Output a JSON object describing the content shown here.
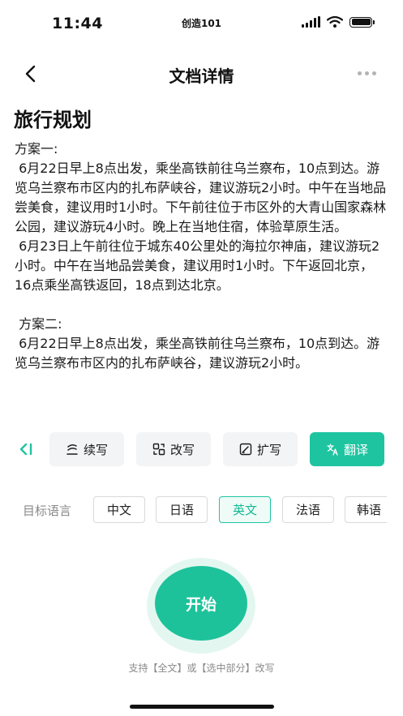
{
  "status_bar": {
    "time": "11:44",
    "carrier": "创造101"
  },
  "nav": {
    "title": "文档详情"
  },
  "document": {
    "title": "旅行规划",
    "body": "方案一:\n 6月22日早上8点出发，乘坐高铁前往乌兰察布，10点到达。游览乌兰察布市区内的扎布萨峡谷，建议游玩2小时。中午在当地品尝美食，建议用时1小时。下午前往位于市区外的大青山国家森林公园，建议游玩4小时。晚上在当地住宿，体验草原生活。\n 6月23日上午前往位于城东40公里处的海拉尔神庙，建议游玩2小时。中午在当地品尝美食，建议用时1小时。下午返回北京，16点乘坐高铁返回，18点到达北京。\n\n 方案二:\n 6月22日早上8点出发，乘坐高铁前往乌兰察布，10点到达。游览乌兰察布市区内的扎布萨峡谷，建议游玩2小时。"
  },
  "toolbar": {
    "buttons": [
      {
        "label": "续写",
        "icon": "continue-write-icon"
      },
      {
        "label": "改写",
        "icon": "rewrite-icon"
      },
      {
        "label": "扩写",
        "icon": "expand-write-icon"
      },
      {
        "label": "翻译",
        "icon": "translate-icon"
      }
    ],
    "active": "翻译",
    "accent_color": "#1ec4a0"
  },
  "language": {
    "label": "目标语言",
    "options": [
      "中文",
      "日语",
      "英文",
      "法语",
      "韩语"
    ],
    "selected": "英文"
  },
  "start_button": {
    "label": "开始"
  },
  "hint": "支持【全文】或【选中部分】改写"
}
